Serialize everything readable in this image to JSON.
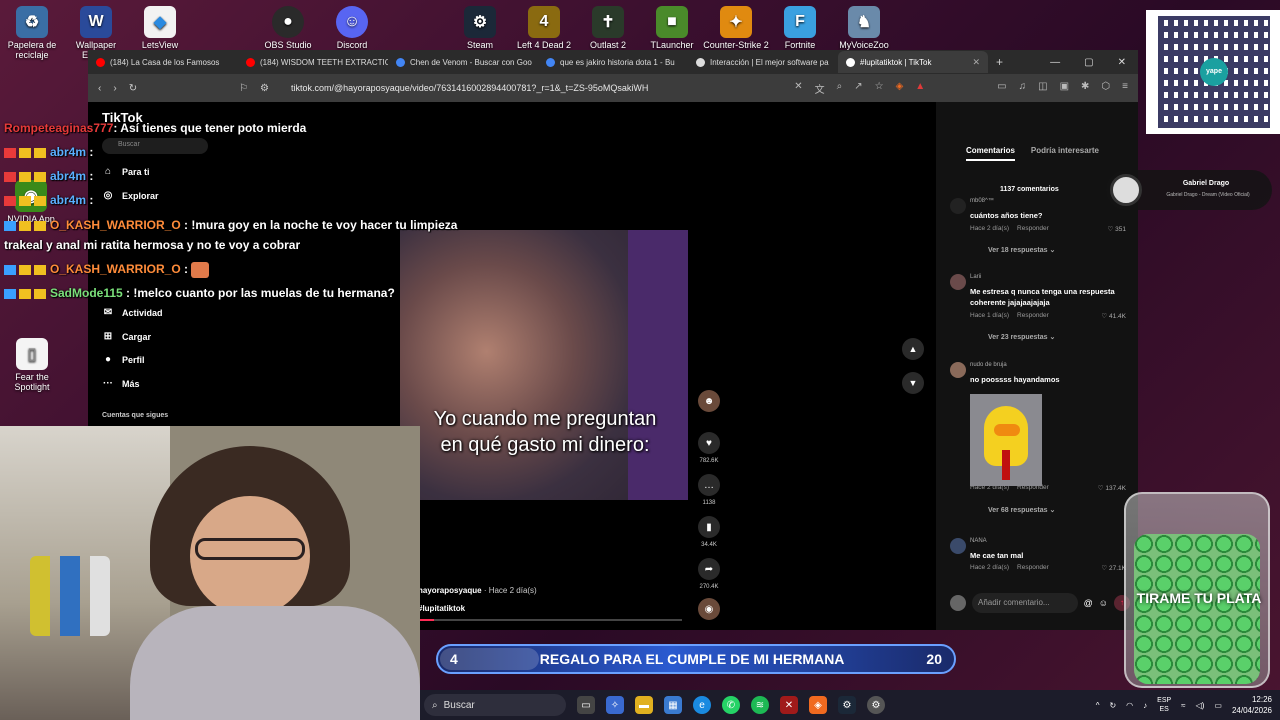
{
  "desktop": {
    "icons": [
      {
        "label": "Papelera de reciclaje",
        "icon": "recycle-bin-icon",
        "color": "#3a6ea5"
      },
      {
        "label": "Wallpaper Engine",
        "icon": "wallpaper-engine-icon",
        "color": "#2a4a9a"
      },
      {
        "label": "LetsView",
        "icon": "letsview-icon",
        "color": "#f2f2f2"
      },
      {
        "label": "OBS Studio",
        "icon": "obs-icon",
        "color": "#2a2a2a"
      },
      {
        "label": "Discord",
        "icon": "discord-icon",
        "color": "#5865f2"
      },
      {
        "label": "Steam",
        "icon": "steam-icon",
        "color": "#1b2838"
      },
      {
        "label": "Left 4 Dead 2",
        "icon": "l4d2-icon",
        "color": "#8a6a10"
      },
      {
        "label": "Outlast 2",
        "icon": "outlast-icon",
        "color": "#2a3a2a"
      },
      {
        "label": "TLauncher",
        "icon": "tlauncher-icon",
        "color": "#4a8a2a"
      },
      {
        "label": "Counter-Strike 2",
        "icon": "cs2-icon",
        "color": "#e08a10"
      },
      {
        "label": "Fortnite",
        "icon": "fortnite-icon",
        "color": "#3aa0e0"
      },
      {
        "label": "MyVoiceZoo",
        "icon": "myvoicezoo-icon",
        "color": "#6a8aaa"
      }
    ],
    "left_icons": [
      {
        "label": "NVIDIA App",
        "icon": "nvidia-icon"
      },
      {
        "label": "Fear the Spotlight",
        "icon": "file-icon"
      }
    ]
  },
  "browser": {
    "tabs": [
      {
        "label": "(184) La Casa de los Famosos",
        "color": "#ff0000"
      },
      {
        "label": "(184) WISDOM TEETH EXTRACTIO",
        "color": "#ff0000"
      },
      {
        "label": "Chen de Venom - Buscar con Goo",
        "color": "#4285f4"
      },
      {
        "label": "que es jakiro historia dota 1 - Bu",
        "color": "#4285f4"
      },
      {
        "label": "Interacción | El mejor software pa",
        "color": "#dddddd"
      },
      {
        "label": "#lupitatiktok | TikTok",
        "color": "#ffffff",
        "active": true
      }
    ],
    "url": "tiktok.com/@hayoraposyaque/video/7631416002894400781?_r=1&_t=ZS-95oMQsakiWH"
  },
  "tiktok": {
    "logo": "TikTok",
    "search_placeholder": "Buscar",
    "nav": [
      {
        "label": "Para ti",
        "icon": "home-icon"
      },
      {
        "label": "Explorar",
        "icon": "compass-icon"
      },
      {
        "label": "Actividad",
        "icon": "inbox-icon"
      },
      {
        "label": "Cargar",
        "icon": "plus-icon"
      },
      {
        "label": "Perfil",
        "icon": "profile-icon"
      },
      {
        "label": "Más",
        "icon": "more-icon"
      }
    ],
    "following_header": "Cuentas que sigues",
    "video": {
      "caption": "Yo cuando me preguntan en qué gasto mi dinero:",
      "author": "hayoraposyaque",
      "time_ago": "· Hace 2 día(s)",
      "hashtag": "#lupitatiktok",
      "progress": 0.06
    },
    "actions": {
      "likes": "782.6K",
      "comments": "1138",
      "saves": "34.4K",
      "shares": "270.4K"
    },
    "comments_panel": {
      "tab_comments": "Comentarios",
      "tab_interest": "Podría interesarte",
      "count": "1137 comentarios",
      "reply_label": "Responder",
      "items": [
        {
          "user": "mb08^™",
          "text": "cuántos años tiene?",
          "time": "Hace 2 día(s)",
          "likes": "351",
          "replies": "Ver 18 respuestas"
        },
        {
          "user": "Larii",
          "text": "Me estresa q nunca tenga una respuesta coherente jajajaajajaja",
          "time": "Hace 1 día(s)",
          "likes": "41.4K",
          "replies": "Ver 23 respuestas"
        },
        {
          "user": "nudo de bruja",
          "text": "no poossss hayandamos",
          "time": "Hace 2 día(s)",
          "likes": "137.4K",
          "replies": "Ver 68 respuestas"
        },
        {
          "user": "NANA",
          "text": "Me cae tan mal",
          "time": "Hace 2 día(s)",
          "likes": "27.1K"
        }
      ],
      "input_placeholder": "Añadir comentario..."
    }
  },
  "stream": {
    "chat": [
      {
        "user": "Rompeteaginas777",
        "text": ": Así tienes que tener poto mierda",
        "color": "red"
      },
      {
        "user": "abr4m",
        "text": ":",
        "color": "blue"
      },
      {
        "user": "abr4m",
        "text": ":",
        "color": "blue"
      },
      {
        "user": "abr4m",
        "text": ":",
        "color": "blue"
      },
      {
        "user": "O_KASH_WARRIOR_O",
        "text": ": !mura goy en la noche te voy hacer tu limpieza",
        "color": "orange"
      },
      {
        "user": "",
        "text": "trakeal y anal mi ratita hermosa y no te voy a cobrar",
        "color": "orange"
      },
      {
        "user": "O_KASH_WARRIOR_O",
        "text": ":",
        "color": "orange"
      },
      {
        "user": "SadMode115",
        "text": ": !melco cuanto por las muelas de tu hermana?",
        "color": "green"
      }
    ],
    "goal": {
      "current": "4",
      "label": "REGALO PARA EL CUMPLE DE MI HERMANA",
      "target": "20",
      "fraction": 0.2
    },
    "jar_text": "TIRAME TU PLATA",
    "qr_label": "yape",
    "now_playing": {
      "name": "Gabriel Drago",
      "song": "Gabriel Drago - Dream (Video Oficial)"
    }
  },
  "taskbar": {
    "search": "Buscar",
    "lang_top": "ESP",
    "lang_bottom": "ES",
    "time": "12:26",
    "date": "24/04/2026"
  }
}
